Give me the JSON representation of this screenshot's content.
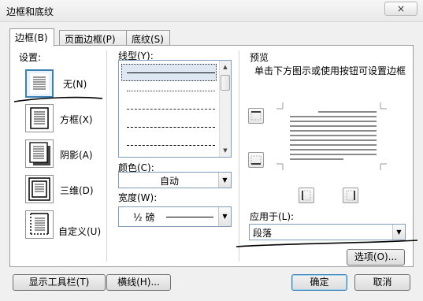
{
  "window": {
    "title": "边框和底纹",
    "close_symbol": "×"
  },
  "tabs": [
    {
      "label": "边框(B)",
      "active": true
    },
    {
      "label": "页面边框(P)",
      "active": false
    },
    {
      "label": "底纹(S)",
      "active": false
    }
  ],
  "settings": {
    "heading": "设置:",
    "items": [
      {
        "label": "无(N)",
        "selected": true
      },
      {
        "label": "方框(X)",
        "selected": false
      },
      {
        "label": "阴影(A)",
        "selected": false
      },
      {
        "label": "三维(D)",
        "selected": false
      },
      {
        "label": "自定义(U)",
        "selected": false
      }
    ]
  },
  "style": {
    "heading": "线型(Y):",
    "line_styles": [
      "solid",
      "dotted",
      "dashed-small",
      "dashed",
      "dash-dot"
    ]
  },
  "color": {
    "label": "颜色(C):",
    "value": "自动"
  },
  "width": {
    "label": "宽度(W):",
    "value": "½ 磅"
  },
  "preview": {
    "heading": "预览",
    "instruction": "单击下方图示或使用按钮可设置边框",
    "apply_to_label": "应用于(L):",
    "apply_to_value": "段落",
    "options_button": "选项(O)..."
  },
  "footer": {
    "toolbar_button": "显示工具栏(T)",
    "hline_button": "横线(H)...",
    "ok_button": "确定",
    "cancel_button": "取消"
  },
  "colors": {
    "accent": "#3c7fb1",
    "panel_border": "#9a9a9a"
  }
}
